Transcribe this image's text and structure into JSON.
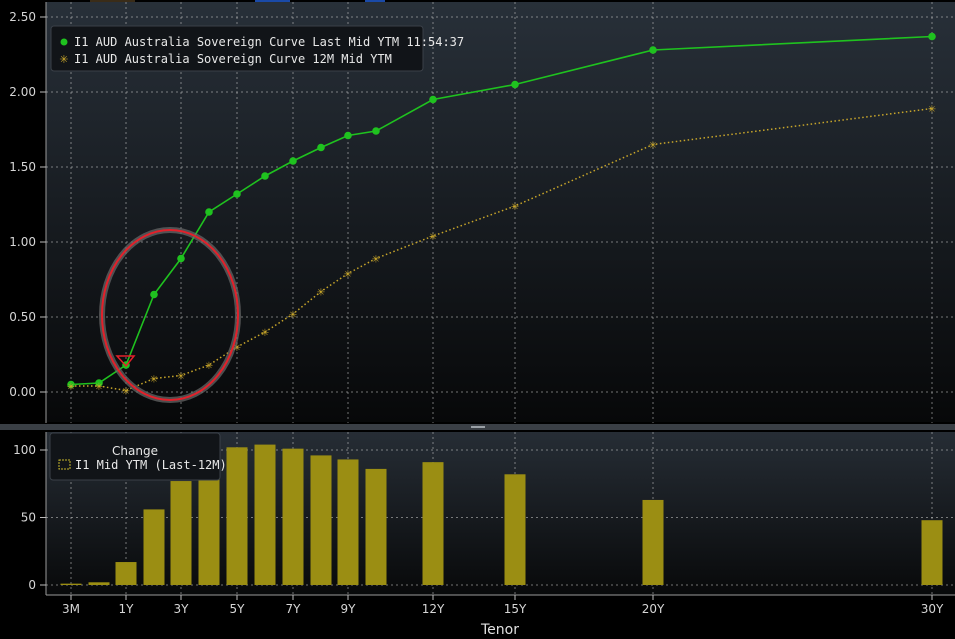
{
  "chart_data": [
    {
      "type": "line",
      "x": [
        "3M",
        "6M",
        "1Y",
        "2Y",
        "3Y",
        "4Y",
        "5Y",
        "6Y",
        "7Y",
        "8Y",
        "9Y",
        "10Y",
        "12Y",
        "15Y",
        "20Y",
        "30Y"
      ],
      "ylim": [
        0,
        2.5
      ],
      "yticks": [
        "0.00",
        "0.50",
        "1.00",
        "1.50",
        "2.00",
        "2.50"
      ],
      "grid": true,
      "legend_position": "top-left",
      "series": [
        {
          "name": "I1 AUD Australia Sovereign Curve Last Mid YTM 11:54:37",
          "color": "#1fc21f",
          "marker": "dot",
          "style": "solid",
          "values": [
            0.05,
            0.06,
            0.18,
            0.65,
            0.89,
            1.2,
            1.32,
            1.44,
            1.54,
            1.63,
            1.71,
            1.74,
            1.95,
            2.05,
            2.28,
            2.37
          ]
        },
        {
          "name": "I1 AUD Australia Sovereign Curve 12M Mid YTM",
          "color": "#c8a62a",
          "marker": "star",
          "style": "dotted",
          "values": [
            0.04,
            0.04,
            0.01,
            0.09,
            0.11,
            0.18,
            0.3,
            0.4,
            0.52,
            0.67,
            0.79,
            0.89,
            1.04,
            1.24,
            1.65,
            1.89
          ]
        }
      ],
      "annotation": "red-circle-highlight-1Y-4Y"
    },
    {
      "type": "bar",
      "categories": [
        "3M",
        "6M",
        "1Y",
        "2Y",
        "3Y",
        "4Y",
        "5Y",
        "6Y",
        "7Y",
        "8Y",
        "9Y",
        "10Y",
        "12Y",
        "15Y",
        "20Y",
        "30Y"
      ],
      "ylim": [
        0,
        110
      ],
      "yticks": [
        "0",
        "50",
        "100"
      ],
      "xtick_labels": [
        "3M",
        "1Y",
        "3Y",
        "5Y",
        "7Y",
        "9Y",
        "12Y",
        "15Y",
        "20Y",
        "30Y"
      ],
      "xlabel": "Tenor",
      "legend_title": "Change",
      "series": [
        {
          "name": "I1 Mid YTM (Last-12M)",
          "color": "#9b8e13",
          "values": [
            1,
            2,
            17,
            56,
            77,
            102,
            102,
            104,
            101,
            96,
            93,
            86,
            91,
            82,
            63,
            48
          ]
        }
      ]
    }
  ]
}
